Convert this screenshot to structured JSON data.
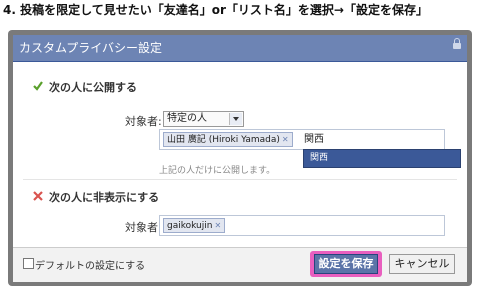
{
  "caption": "4. 投稿を限定して見せたい「友達名」or「リスト名」を選択→「設定を保存」",
  "dialog": {
    "title": "カスタムプライバシー設定",
    "show_section": {
      "heading": "次の人に公開する",
      "target_label": "対象者:",
      "target_select": "特定の人",
      "tokens": [
        "山田 廣記 (Hiroki Yamada)"
      ],
      "typed_text": "関西",
      "hint": "上記の人だけに公開します。",
      "suggestion": "関西"
    },
    "hide_section": {
      "heading": "次の人に非表示にする",
      "target_label": "対象者:",
      "tokens": [
        "gaikokujin"
      ]
    },
    "footer": {
      "default_checkbox_label": "デフォルトの設定にする",
      "save_label": "設定を保存",
      "cancel_label": "キャンセル"
    }
  },
  "colors": {
    "titlebar": "#6d84b4",
    "save_button": "#5b74a8",
    "highlight": "#e95fbf",
    "suggestion": "#3b5998"
  },
  "icons": {
    "show": "check-icon",
    "hide": "x-icon",
    "lock": "lock-icon",
    "select": "chevron-down-icon",
    "token_remove": "close-icon"
  }
}
